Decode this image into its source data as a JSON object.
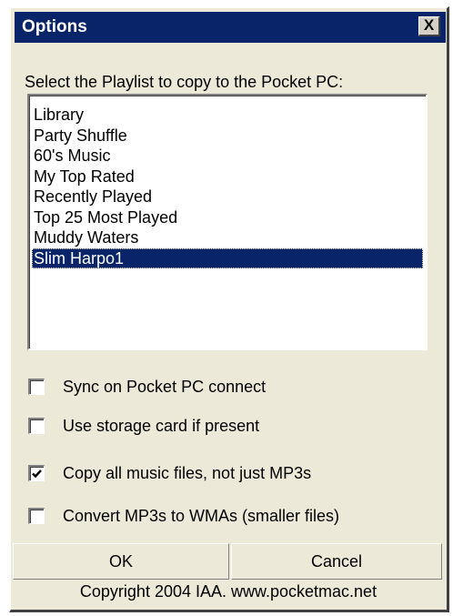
{
  "window": {
    "title": "Options",
    "close_label": "X"
  },
  "prompt": "Select the Playlist to copy to the Pocket PC:",
  "playlists": {
    "items": [
      "Library",
      "Party Shuffle",
      "60's Music",
      "My Top Rated",
      "Recently Played",
      "Top 25 Most Played",
      "Muddy Waters",
      "Slim Harpo1"
    ],
    "selected": "Slim Harpo1"
  },
  "options": [
    {
      "label": "Sync on Pocket PC connect",
      "checked": false
    },
    {
      "label": "Use storage card if present",
      "checked": false
    },
    {
      "label": "Copy all music files, not just MP3s",
      "checked": true
    },
    {
      "label": "Convert MP3s to WMAs (smaller files)",
      "checked": false
    }
  ],
  "buttons": {
    "ok": "OK",
    "cancel": "Cancel"
  },
  "footer": "Copyright 2004 IAA. www.pocketmac.net",
  "colors": {
    "titlebar": "#0a246a",
    "selection": "#0a246a",
    "dialog_face": "#ece9d8"
  },
  "icons": {
    "close": "close-icon",
    "check": "checkmark-icon"
  }
}
